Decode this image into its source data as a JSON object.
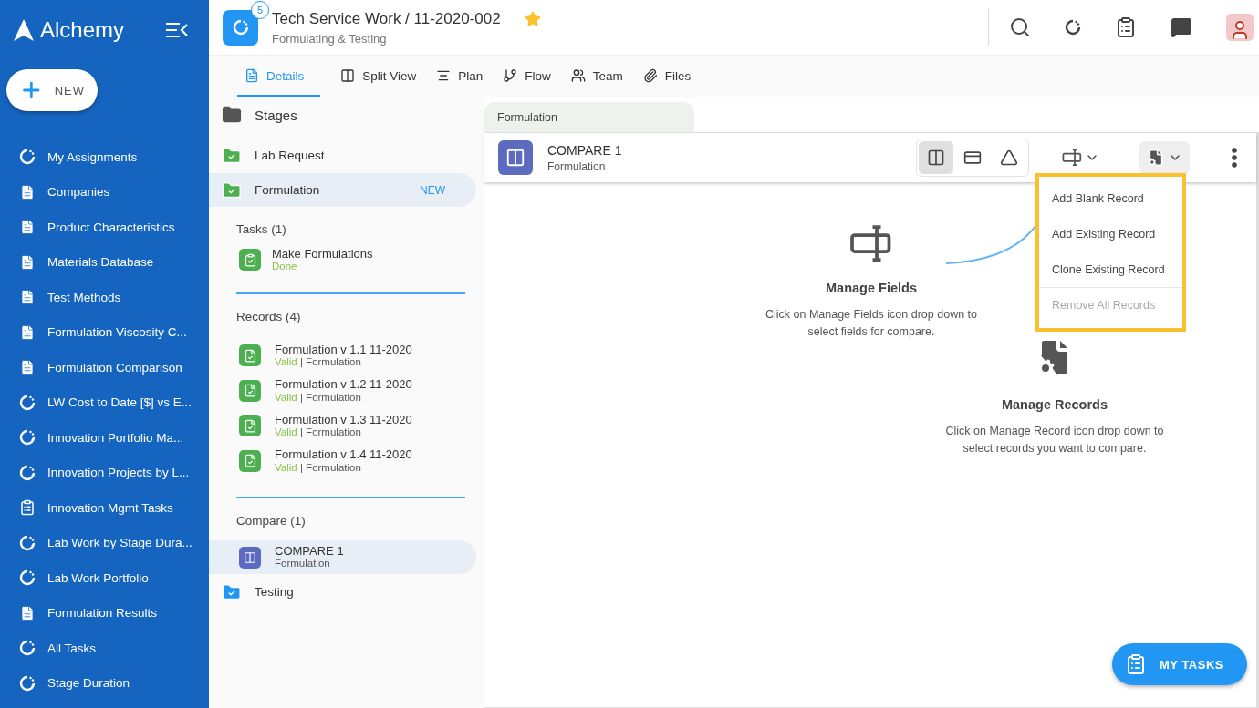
{
  "sidebar": {
    "brand": "Alchemy",
    "new_button": "NEW",
    "items": [
      {
        "kind": "loader",
        "label": "My Assignments"
      },
      {
        "kind": "doc",
        "label": "Companies"
      },
      {
        "kind": "doc",
        "label": "Product Characteristics"
      },
      {
        "kind": "doc",
        "label": "Materials Database"
      },
      {
        "kind": "doc",
        "label": "Test Methods"
      },
      {
        "kind": "doc",
        "label": "Formulation Viscosity C..."
      },
      {
        "kind": "doc",
        "label": "Formulation Comparison"
      },
      {
        "kind": "loader",
        "label": "LW Cost to Date [$] vs E..."
      },
      {
        "kind": "loader",
        "label": "Innovation Portfolio Ma..."
      },
      {
        "kind": "loader",
        "label": "Innovation Projects by L..."
      },
      {
        "kind": "clipboard",
        "label": "Innovation Mgmt Tasks"
      },
      {
        "kind": "loader",
        "label": "Lab Work by Stage Dura..."
      },
      {
        "kind": "loader",
        "label": "Lab Work Portfolio"
      },
      {
        "kind": "doc",
        "label": "Formulation Results"
      },
      {
        "kind": "loader",
        "label": "All Tasks"
      },
      {
        "kind": "loader",
        "label": "Stage Duration"
      }
    ]
  },
  "header": {
    "badge": "5",
    "title": "Tech Service Work / 11-2020-002",
    "subtitle": "Formulating & Testing",
    "starred": true
  },
  "tabs": [
    {
      "kind": "details",
      "label": "Details",
      "selected": true
    },
    {
      "kind": "split",
      "label": "Split View",
      "selected": false
    },
    {
      "kind": "plan",
      "label": "Plan",
      "selected": false
    },
    {
      "kind": "flow",
      "label": "Flow",
      "selected": false
    },
    {
      "kind": "team",
      "label": "Team",
      "selected": false
    },
    {
      "kind": "files",
      "label": "Files",
      "selected": false
    }
  ],
  "stages": {
    "title": "Stages",
    "items": [
      {
        "label": "Lab Request",
        "color": "#4caf50",
        "selected": false
      },
      {
        "label": "Formulation",
        "color": "#4caf50",
        "selected": true,
        "badge": "NEW",
        "sections": [
          {
            "title": "Tasks (1)",
            "kind": "task",
            "items": [
              {
                "name": "Make Formulations",
                "status": "Done"
              }
            ]
          },
          {
            "title": "Records (4)",
            "kind": "record",
            "items": [
              {
                "name": "Formulation v 1.1 11-2020",
                "status": "Valid",
                "type": "| Formulation",
                "selected": false
              },
              {
                "name": "Formulation v 1.2 11-2020",
                "status": "Valid",
                "type": "| Formulation",
                "selected": false
              },
              {
                "name": "Formulation v 1.3 11-2020",
                "status": "Valid",
                "type": "| Formulation",
                "selected": false
              },
              {
                "name": "Formulation v 1.4 11-2020",
                "status": "Valid",
                "type": "| Formulation",
                "selected": false
              }
            ]
          },
          {
            "title": "Compare (1)",
            "kind": "compare",
            "items": [
              {
                "name": "COMPARE 1",
                "type": "Formulation",
                "selected": true
              }
            ]
          }
        ]
      },
      {
        "label": "Testing",
        "color": "#2196f3",
        "selected": false
      }
    ]
  },
  "stage_tab": "Formulation",
  "card": {
    "title": "COMPARE 1",
    "subtitle": "Formulation",
    "view_buttons": [
      {
        "kind": "compare",
        "selected": true
      },
      {
        "kind": "card",
        "selected": false
      },
      {
        "kind": "triangle",
        "selected": false
      }
    ],
    "menu": [
      {
        "label": "Add Blank Record",
        "disabled": false
      },
      {
        "label": "Add Existing Record",
        "disabled": false
      },
      {
        "label": "Clone Existing Record",
        "disabled": false
      },
      {
        "label": "Remove All Records",
        "disabled": true
      }
    ],
    "hints": [
      {
        "kind": "fields",
        "title": "Manage Fields",
        "text": "Click on Manage Fields icon drop down to select fields for compare."
      },
      {
        "kind": "records",
        "title": "Manage Records",
        "text": "Click on Manage Record icon drop down to select records you want to compare."
      }
    ]
  },
  "my_tasks": "MY TASKS"
}
